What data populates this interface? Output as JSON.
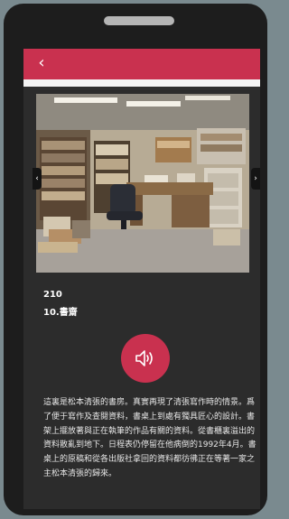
{
  "header": {
    "back_label": "‹",
    "accent_color": "#c9314f"
  },
  "gallery": {
    "photo_subject": "study room with desk, chair, bookshelves and file cabinets",
    "prev_label": "‹",
    "next_label": "›"
  },
  "entry": {
    "number": "210",
    "title": "10.書齋"
  },
  "audio": {
    "icon": "speaker-icon"
  },
  "description": "這裏是松本清張的書房。真實再現了清張寫作時的情景。爲了便于寫作及查閱資料，書桌上到處有獨具匠心的設計。書架上擺放著與正在執筆的作品有關的資料。從書櫃裏溢出的資料散亂到地下。日程表仍停留在他病倒的1992年4月。書桌上的原稿和從各出版社拿回的資料都彷彿正在等著一家之主松本清張的歸來。"
}
